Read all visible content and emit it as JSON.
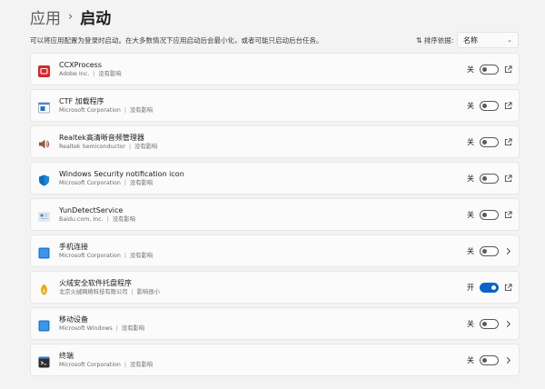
{
  "breadcrumb": {
    "parent": "应用",
    "separator": "›",
    "current": "启动"
  },
  "description": "可以将应用配置为登录时启动。在大多数情况下应用启动后会最小化，或者可能只启动后台任务。",
  "sort": {
    "label": "排序依据:",
    "value": "名称"
  },
  "apps": [
    {
      "name": "CCXProcess",
      "publisher": "Adobe Inc.",
      "impact": "没有影响",
      "state": "关",
      "on": false,
      "action": "open-external",
      "icon": "adobe-icon"
    },
    {
      "name": "CTF 加载程序",
      "publisher": "Microsoft Corporation",
      "impact": "没有影响",
      "state": "关",
      "on": false,
      "action": "open-external",
      "icon": "ctf-loader-icon"
    },
    {
      "name": "Realtek高清晰音频管理器",
      "publisher": "Realtek Semiconductor",
      "impact": "没有影响",
      "state": "关",
      "on": false,
      "action": "open-external",
      "icon": "speaker-icon"
    },
    {
      "name": "Windows Security notification icon",
      "publisher": "Microsoft Corporation",
      "impact": "没有影响",
      "state": "关",
      "on": false,
      "action": "open-external",
      "icon": "shield-icon"
    },
    {
      "name": "YunDetectService",
      "publisher": "Baidu.com, Inc.",
      "impact": "没有影响",
      "state": "关",
      "on": false,
      "action": "open-external",
      "icon": "yun-icon"
    },
    {
      "name": "手机连接",
      "publisher": "Microsoft Corporation",
      "impact": "没有影响",
      "state": "关",
      "on": false,
      "action": "chevron",
      "icon": "phone-link-icon"
    },
    {
      "name": "火绒安全软件托盘程序",
      "publisher": "北京火绒网络科技有限公司",
      "impact": "影响很小",
      "state": "开",
      "on": true,
      "action": "open-external",
      "icon": "huorong-icon"
    },
    {
      "name": "移动设备",
      "publisher": "Microsoft Windows",
      "impact": "没有影响",
      "state": "关",
      "on": false,
      "action": "chevron",
      "icon": "mobile-device-icon"
    },
    {
      "name": "终端",
      "publisher": "Microsoft Corporation",
      "impact": "没有影响",
      "state": "关",
      "on": false,
      "action": "chevron",
      "icon": "terminal-icon"
    }
  ],
  "colors": {
    "accent": "#0a63c9",
    "background": "#f3f3f3",
    "card": "#fbfbfb"
  }
}
